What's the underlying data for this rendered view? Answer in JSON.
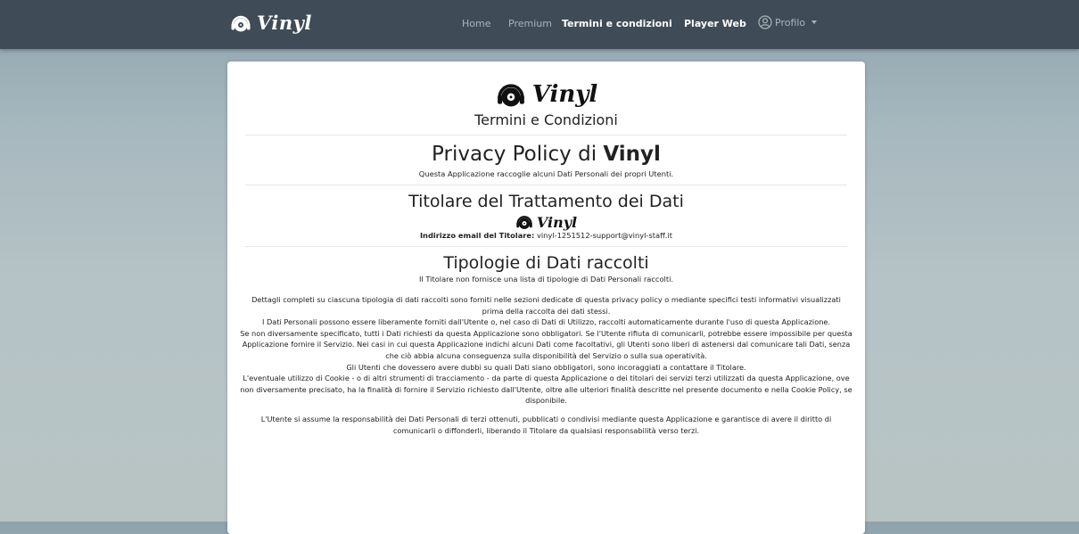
{
  "navbar": {
    "brand": "Vinyl",
    "links": [
      {
        "label": "Home",
        "active": false
      },
      {
        "label": "Premium",
        "active": false
      },
      {
        "label": "Termini e condizioni",
        "active": true
      },
      {
        "label": "Player Web",
        "active": false
      }
    ],
    "profile_label": "Profilo"
  },
  "card": {
    "brand": "Vinyl",
    "subtitle": "Termini e Condizioni",
    "title_prefix": "Privacy Policy di",
    "title_brand": "Vinyl",
    "title_desc": "Questa Applicazione raccoglie alcuni Dati Personali dei propri Utenti.",
    "owner_heading": "Titolare del Trattamento dei Dati",
    "owner_brand": "Vinyl",
    "owner_email_label": "Indirizzo email del Titolare:",
    "owner_email": "vinyl-1251512-support@vinyl-staff.it",
    "types_heading": "Tipologie di Dati raccolti",
    "types_desc": "Il Titolare non fornisce una lista di tipologie di Dati Personali raccolti.",
    "paragraph1": [
      "Dettagli completi su ciascuna tipologia di dati raccolti sono forniti nelle sezioni dedicate di questa privacy policy o mediante specifici testi informativi visualizzati prima della raccolta dei dati stessi.",
      "I Dati Personali possono essere liberamente forniti dall'Utente o, nel caso di Dati di Utilizzo, raccolti automaticamente durante l'uso di questa Applicazione.",
      "Se non diversamente specificato, tutti i Dati richiesti da questa Applicazione sono obbligatori. Se l'Utente rifiuta di comunicarli, potrebbe essere impossibile per questa Applicazione fornire il Servizio. Nei casi in cui questa Applicazione indichi alcuni Dati come facoltativi, gli Utenti sono liberi di astenersi dal comunicare tali Dati, senza che ciò abbia alcuna conseguenza sulla disponibilità del Servizio o sulla sua operatività.",
      "Gli Utenti che dovessero avere dubbi su quali Dati siano obbligatori, sono incoraggiati a contattare il Titolare.",
      "L'eventuale utilizzo di Cookie - o di altri strumenti di tracciamento - da parte di questa Applicazione o dei titolari dei servizi terzi utilizzati da questa Applicazione, ove non diversamente precisato, ha la finalità di fornire il Servizio richiesto dall'Utente, oltre alle ulteriori finalità descritte nel presente documento e nella Cookie Policy, se disponibile."
    ],
    "paragraph2": "L'Utente si assume la responsabilità dei Dati Personali di terzi ottenuti, pubblicati o condivisi mediante questa Applicazione e garantisce di avere il diritto di comunicarli o diffonderli, liberando il Titolare da qualsiasi responsabilità verso terzi."
  }
}
